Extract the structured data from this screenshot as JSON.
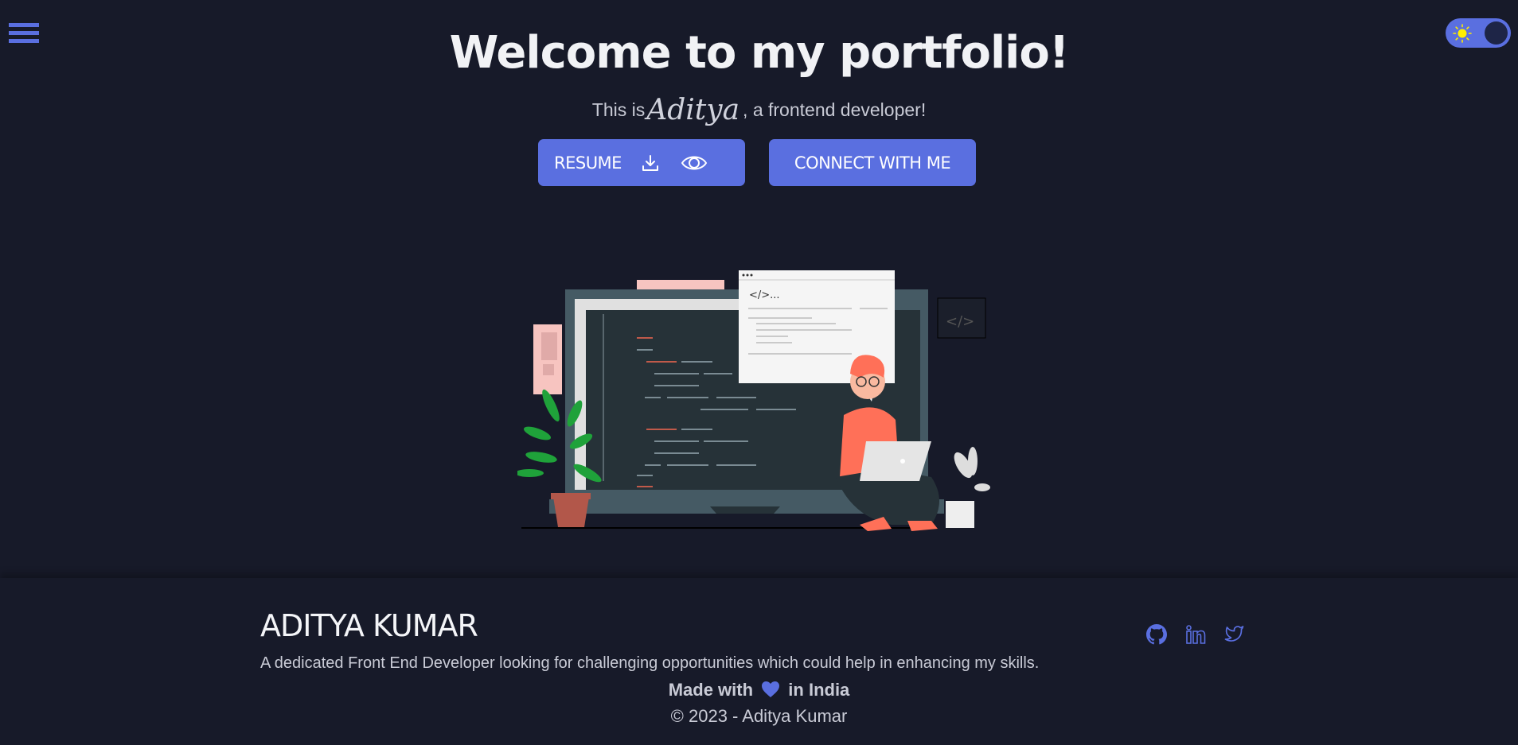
{
  "header": {
    "menu_icon": "hamburger-menu-icon",
    "theme_toggle": {
      "icon": "sun-icon",
      "state": "dark",
      "accent": "#5a6fe0"
    }
  },
  "hero": {
    "title": "Welcome to my portfolio!",
    "subtitle_prefix": "This is",
    "subtitle_name": "Aditya",
    "subtitle_suffix": ", a frontend developer!",
    "buttons": {
      "resume": {
        "label": "RESUME",
        "icons": [
          "download-icon",
          "eye-icon"
        ]
      },
      "connect": {
        "label": "CONNECT WITH ME"
      }
    },
    "illustration": "developer-working-on-laptop-illustration",
    "illustration_code_text": "</>..."
  },
  "footer": {
    "name": "ADITYA KUMAR",
    "description": "A dedicated Front End Developer looking for challenging opportunities which could help in enhancing my skills.",
    "social": [
      "github-icon",
      "linkedin-icon",
      "twitter-icon"
    ],
    "made_with_prefix": "Made with",
    "made_with_suffix": "in India",
    "copyright": "© 2023 - Aditya Kumar"
  },
  "colors": {
    "background": "#171a29",
    "accent": "#5a6fe0",
    "text": "#f1f2f5",
    "muted_text": "#c9cbd6",
    "sun": "#ffee00"
  }
}
